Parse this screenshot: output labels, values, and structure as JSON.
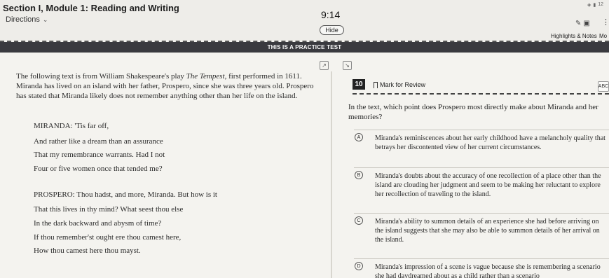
{
  "header": {
    "section_title": "Section I, Module 1: Reading and Writing",
    "directions_label": "Directions",
    "timer": "9:14",
    "hide_label": "Hide",
    "highlights_label": "Highlights & Notes",
    "more_label": "Mo",
    "battery": "12"
  },
  "banner": {
    "text": "THIS IS A PRACTICE TEST"
  },
  "passage": {
    "intro_before": "The following text is from William Shakespeare's play ",
    "intro_work": "The Tempest",
    "intro_after": ", first performed in 1611. Miranda has lived on an island with her father, Prospero, since she was three years old. Prospero has stated that Miranda likely does not remember anything other than her life on the island.",
    "lines": [
      "MIRANDA: 'Tis far off,",
      "And rather like a dream than an assurance",
      "That my remembrance warrants. Had I not",
      "Four or five women once that tended me?",
      "PROSPERO: Thou hadst, and more, Miranda. But how is it",
      "That this lives in thy mind? What seest thou else",
      "In the dark backward and abysm of time?",
      "If thou remember'st ought ere thou camest here,",
      "How thou camest here thou mayst."
    ]
  },
  "question": {
    "number": "10",
    "mark_for_review": "Mark for Review",
    "abc_label": "ABC",
    "stem": "In the text, which point does Prospero most directly make about Miranda and her memories?",
    "options": [
      {
        "letter": "A",
        "text": "Miranda's reminiscences about her early childhood have a melancholy quality that betrays her discontented view of her current circumstances."
      },
      {
        "letter": "B",
        "text": "Miranda's doubts about the accuracy of one recollection of a place other than the island are clouding her judgment and seem to be making her reluctant to explore her recollection of traveling to the island."
      },
      {
        "letter": "C",
        "text": "Miranda's ability to summon details of an experience she had before arriving on the island suggests that she may also be able to summon details of her arrival on the island."
      },
      {
        "letter": "D",
        "text": "Miranda's impression of a scene is vague because she is remembering a scenario she had daydreamed about as a child rather than a scenario"
      }
    ]
  }
}
